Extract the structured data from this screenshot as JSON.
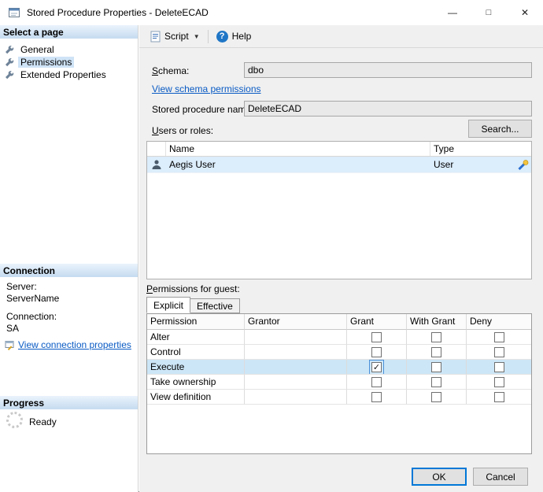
{
  "window": {
    "title": "Stored Procedure Properties - DeleteECAD",
    "minimize_glyph": "—",
    "maximize_glyph": "□",
    "close_glyph": "✕"
  },
  "sidebar": {
    "select_page_header": "Select a page",
    "pages": [
      {
        "label": "General",
        "selected": false
      },
      {
        "label": "Permissions",
        "selected": true
      },
      {
        "label": "Extended Properties",
        "selected": false
      }
    ],
    "connection": {
      "header": "Connection",
      "server_label": "Server:",
      "server_value": "ServerName",
      "connection_label": "Connection:",
      "connection_value": "SA",
      "view_link": "View connection properties"
    },
    "progress": {
      "header": "Progress",
      "status": "Ready"
    }
  },
  "toolbar": {
    "script_label": "Script",
    "dropdown_glyph": "▼",
    "help_label": "Help",
    "help_glyph": "?"
  },
  "form": {
    "schema_label": "Schema:",
    "schema_value": "dbo",
    "schema_link": "View schema permissions",
    "proc_name_label": "Stored procedure name:",
    "proc_name_value": "DeleteECAD",
    "users_label": "Users or roles:",
    "search_button": "Search...",
    "users_table": {
      "name_header": "Name",
      "type_header": "Type",
      "rows": [
        {
          "name": "Aegis User",
          "type": "User",
          "selected": true
        }
      ]
    },
    "permissions_label": "Permissions for guest:",
    "tabs": [
      {
        "label": "Explicit",
        "active": true
      },
      {
        "label": "Effective",
        "active": false
      }
    ],
    "grid": {
      "check_glyph": "✓",
      "columns": [
        "Permission",
        "Grantor",
        "Grant",
        "With Grant",
        "Deny"
      ],
      "rows": [
        {
          "permission": "Alter",
          "grantor": "",
          "grant": false,
          "with_grant": false,
          "deny": false,
          "selected": false
        },
        {
          "permission": "Control",
          "grantor": "",
          "grant": false,
          "with_grant": false,
          "deny": false,
          "selected": false
        },
        {
          "permission": "Execute",
          "grantor": "",
          "grant": true,
          "with_grant": false,
          "deny": false,
          "selected": true
        },
        {
          "permission": "Take ownership",
          "grantor": "",
          "grant": false,
          "with_grant": false,
          "deny": false,
          "selected": false
        },
        {
          "permission": "View definition",
          "grantor": "",
          "grant": false,
          "with_grant": false,
          "deny": false,
          "selected": false
        }
      ]
    }
  },
  "footer": {
    "ok_label": "OK",
    "cancel_label": "Cancel"
  },
  "colors": {
    "accent": "#0078d7",
    "link": "#0a5bc4",
    "grid_selection": "#cde6f7",
    "row_selection": "#dcedfb",
    "section_header_top": "#eaf3fc",
    "section_header_bottom": "#c5dbf0"
  }
}
